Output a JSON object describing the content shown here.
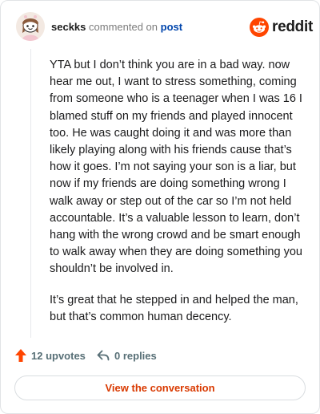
{
  "header": {
    "username": "seckks",
    "action_text": "commented on",
    "post_link": "post",
    "brand": "reddit",
    "brand_color": "#ff4500",
    "avatar_icon": "snoo-avatar-icon",
    "logo_icon": "reddit-snoo-icon"
  },
  "comment": {
    "paragraphs": [
      "YTA but I don’t think you are in a bad way. now hear me out, I want to stress something, coming from someone who is a teenager when I was 16 I blamed stuff on my friends and played innocent too. He was caught doing it and was more than likely playing along with his friends cause that’s how it goes. I’m not saying your son is a liar, but now if my friends are doing something wrong I walk away or step out of the car so I’m not held accountable. It’s a valuable lesson to learn, don’t hang with the wrong crowd and be smart enough to walk away when they are doing something you shouldn’t be involved in.",
      "It’s great that he stepped in and helped the man, but that’s common human decency."
    ]
  },
  "meta": {
    "upvotes": "12 upvotes",
    "replies": "0 replies",
    "upvote_icon": "upvote-arrow-icon",
    "reply_icon": "reply-arrow-icon",
    "upvote_color": "#ff4500"
  },
  "footer": {
    "button_label": "View the conversation",
    "button_color": "#d93900"
  }
}
